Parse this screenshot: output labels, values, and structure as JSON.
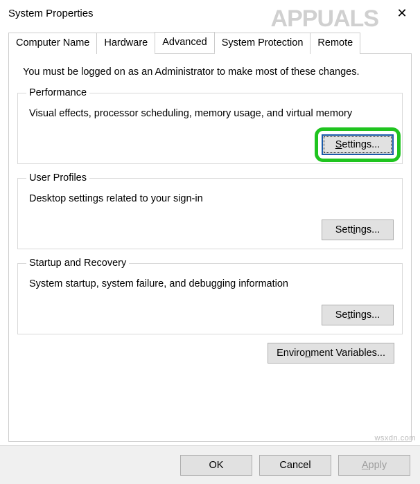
{
  "window": {
    "title": "System Properties"
  },
  "tabs": {
    "computer_name": "Computer Name",
    "hardware": "Hardware",
    "advanced": "Advanced",
    "system_protection": "System Protection",
    "remote": "Remote"
  },
  "advanced": {
    "intro": "You must be logged on as an Administrator to make most of these changes.",
    "performance": {
      "legend": "Performance",
      "desc": "Visual effects, processor scheduling, memory usage, and virtual memory",
      "button_prefix": "S",
      "button_suffix": "ettings..."
    },
    "user_profiles": {
      "legend": "User Profiles",
      "desc": "Desktop settings related to your sign-in",
      "button_prefix": "Sett",
      "button_suffix": "ngs...",
      "button_mnemonic": "i"
    },
    "startup": {
      "legend": "Startup and Recovery",
      "desc": "System startup, system failure, and debugging information",
      "button_prefix": "Se",
      "button_suffix": "tings...",
      "button_mnemonic": "t"
    },
    "env_btn_prefix": "Enviro",
    "env_btn_suffix": "ment Variables...",
    "env_btn_mnemonic": "n"
  },
  "buttons": {
    "ok": "OK",
    "cancel": "Cancel",
    "apply_prefix": "A",
    "apply_suffix": "pply"
  },
  "watermark": {
    "logo_text": "APPUALS",
    "source": "wsxdn.com"
  }
}
